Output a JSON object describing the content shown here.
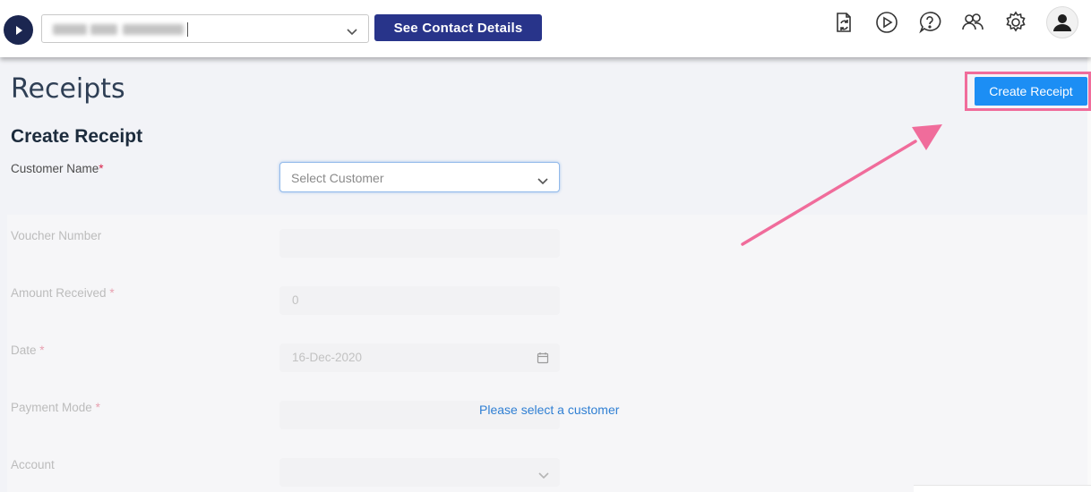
{
  "header": {
    "contact_button": "See Contact Details",
    "icons": [
      "sync-document-icon",
      "play-circle-icon",
      "help-chat-icon",
      "users-icon",
      "gear-icon",
      "user-avatar-icon"
    ]
  },
  "page": {
    "title": "Receipts",
    "create_button": "Create Receipt",
    "section_title": "Create Receipt"
  },
  "form": {
    "customer_label": "Customer Name",
    "customer_placeholder": "Select Customer",
    "voucher_label": "Voucher Number",
    "amount_label": "Amount Received",
    "amount_value": "0",
    "date_label": "Date",
    "date_value": "16-Dec-2020",
    "payment_label": "Payment Mode",
    "account_label": "Account",
    "required_mark": "*",
    "select_customer_message": "Please select a customer"
  },
  "colors": {
    "primary_button": "#1c8ef4",
    "contact_button": "#28348a",
    "highlight": "#f06c9b",
    "link": "#2f7fd3"
  }
}
